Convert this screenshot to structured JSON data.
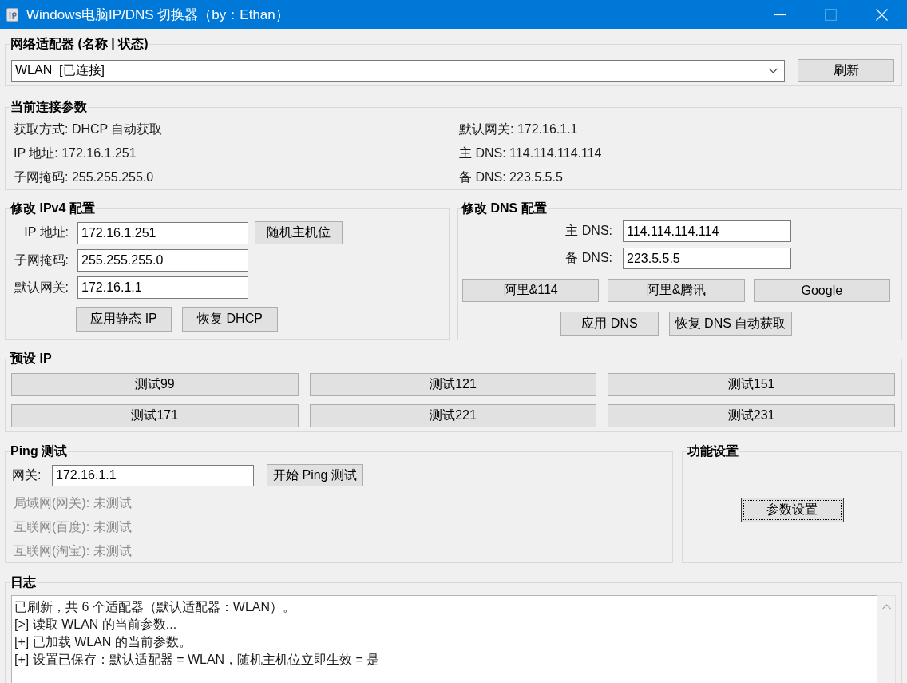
{
  "window": {
    "title": "Windows电脑IP/DNS 切换器（by：Ethan）",
    "maximize_disabled": true
  },
  "adapter": {
    "title": "网络适配器 (名称 | 状态)",
    "value": "WLAN  [已连接]",
    "refresh": "刷新"
  },
  "current": {
    "title": "当前连接参数",
    "items": [
      "获取方式: DHCP 自动获取",
      "默认网关: 172.16.1.1",
      "IP 地址: 172.16.1.251",
      "主 DNS: 114.114.114.114",
      "子网掩码: 255.255.255.0",
      "备 DNS: 223.5.5.5"
    ]
  },
  "ipv4": {
    "title": "修改 IPv4 配置",
    "fields": [
      {
        "label": "IP 地址:",
        "value": "172.16.1.251",
        "button": "随机主机位"
      },
      {
        "label": "子网掩码:",
        "value": "255.255.255.0"
      },
      {
        "label": "默认网关:",
        "value": "172.16.1.1"
      }
    ],
    "buttons": [
      "应用静态 IP",
      "恢复 DHCP"
    ]
  },
  "dns": {
    "title": "修改 DNS 配置",
    "fields": [
      {
        "label": "主 DNS:",
        "value": "114.114.114.114"
      },
      {
        "label": "备 DNS:",
        "value": "223.5.5.5"
      }
    ],
    "presets": [
      "阿里&114",
      "阿里&腾讯",
      "Google"
    ],
    "buttons": [
      "应用 DNS",
      "恢复 DNS 自动获取"
    ]
  },
  "preset_ip": {
    "title": "预设 IP",
    "buttons": [
      "测试99",
      "测试121",
      "测试151",
      "测试171",
      "测试221",
      "测试231"
    ]
  },
  "ping": {
    "title": "Ping 测试",
    "label": "网关:",
    "value": "172.16.1.1",
    "button": "开始 Ping 测试",
    "results": [
      "局域网(网关): 未测试",
      "互联网(百度): 未测试",
      "互联网(淘宝): 未测试"
    ]
  },
  "settings": {
    "title": "功能设置",
    "button": {
      "label": "参数设置",
      "focused": true
    }
  },
  "log": {
    "title": "日志",
    "lines": [
      "已刷新，共 6 个适配器（默认适配器：WLAN）。",
      "[>] 读取 WLAN 的当前参数...",
      "[+] 已加载 WLAN 的当前参数。",
      "[+] 设置已保存：默认适配器 = WLAN，随机主机位立即生效 = 是"
    ]
  }
}
